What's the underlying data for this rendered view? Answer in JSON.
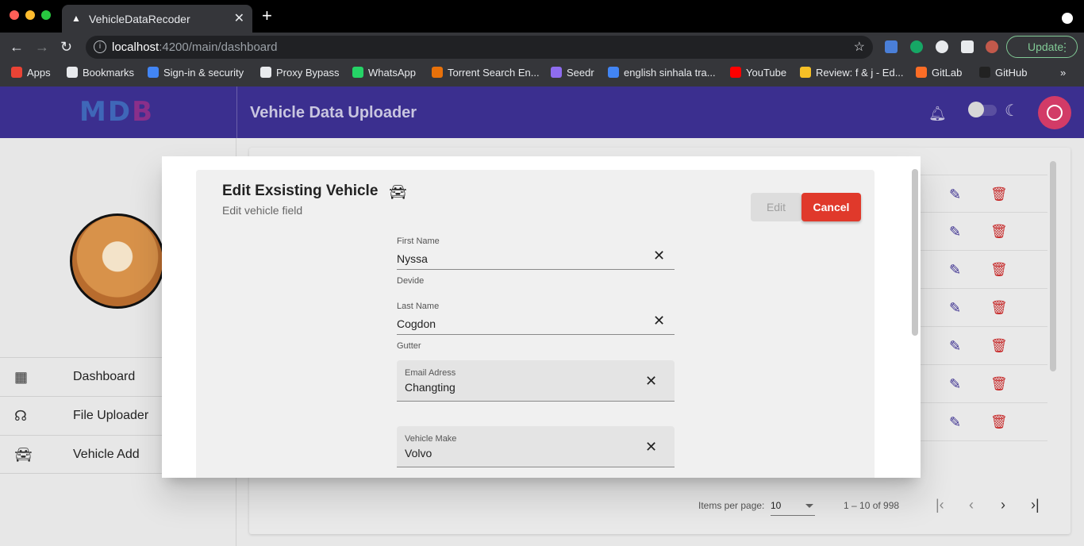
{
  "browser": {
    "tab_title": "VehicleDataRecoder",
    "url_host": "localhost",
    "url_path": ":4200/main/dashboard",
    "update_label": "Update",
    "bookmarks": [
      {
        "label": "Apps",
        "color": "#ea4335"
      },
      {
        "label": "Bookmarks",
        "color": "#e8eaed"
      },
      {
        "label": "Sign-in & security",
        "color": "#4285f4"
      },
      {
        "label": "Proxy Bypass",
        "color": "#e8eaed"
      },
      {
        "label": "WhatsApp",
        "color": "#25d366"
      },
      {
        "label": "Torrent Search En...",
        "color": "#e8710a"
      },
      {
        "label": "Seedr",
        "color": "#8e6cef"
      },
      {
        "label": "english sinhala tra...",
        "color": "#4285f4"
      },
      {
        "label": "YouTube",
        "color": "#ff0000"
      },
      {
        "label": "Review: f & j - Ed...",
        "color": "#f6c026"
      },
      {
        "label": "GitLab",
        "color": "#fc6d26"
      },
      {
        "label": "GitHub",
        "color": "#222222"
      }
    ]
  },
  "app": {
    "logo": "MD",
    "logo_accent": "B",
    "title": "Vehicle Data Uploader",
    "colors": {
      "primary": "#3b2f8f",
      "accent": "#d23b67",
      "warn": "#e0392b"
    },
    "nav": [
      {
        "label": "Dashboard",
        "icon": "dashboard-icon"
      },
      {
        "label": "File Uploader",
        "icon": "record-voice-icon"
      },
      {
        "label": "Vehicle Add",
        "icon": "car-icon"
      }
    ],
    "paginator": {
      "items_per_page_label": "Items per page:",
      "page_size": "10",
      "range_label": "1 – 10 of 998"
    }
  },
  "dialog": {
    "title": "Edit Exsisting Vehicle",
    "subtitle": "Edit vehicle field",
    "edit_label": "Edit",
    "cancel_label": "Cancel",
    "fields": [
      {
        "label": "First Name",
        "value": "Nyssa",
        "hint": "Devide"
      },
      {
        "label": "Last Name",
        "value": "Cogdon",
        "hint": "Gutter"
      },
      {
        "label": "Email Adress",
        "value": "Changting"
      },
      {
        "label": "Vehicle Make",
        "value": "Volvo"
      }
    ]
  }
}
